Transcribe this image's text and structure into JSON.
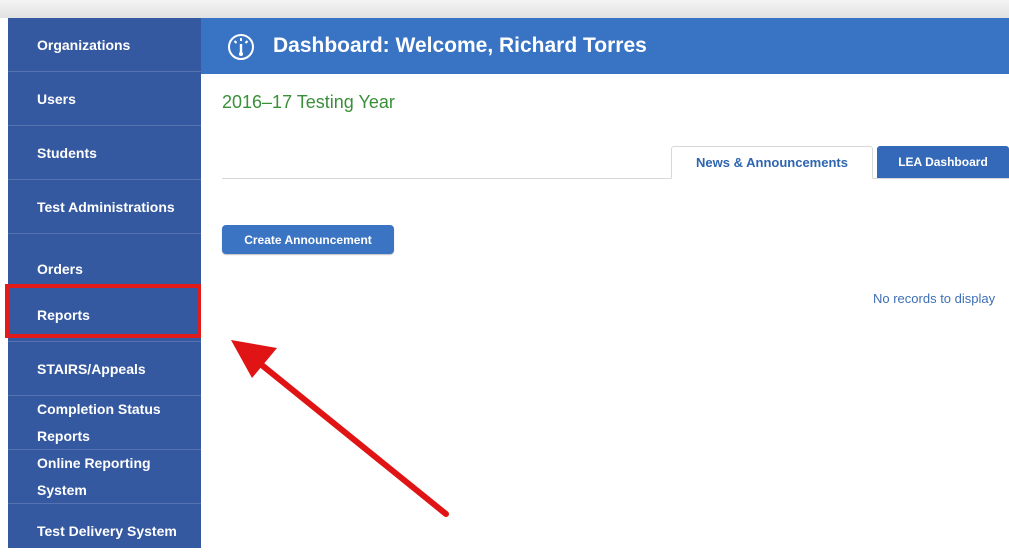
{
  "sidebar": {
    "items": [
      {
        "label": "Organizations"
      },
      {
        "label": "Users"
      },
      {
        "label": "Students"
      },
      {
        "label": "Test Administrations"
      },
      {
        "label": "Orders"
      },
      {
        "label": "Reports"
      },
      {
        "label": "STAIRS/Appeals"
      },
      {
        "line1": "Completion Status",
        "line2": "Reports"
      },
      {
        "line1": "Online Reporting",
        "line2": "System"
      },
      {
        "label": "Test Delivery System"
      }
    ]
  },
  "header": {
    "title": "Dashboard: Welcome, Richard Torres",
    "icon": "dashboard-gauge-icon"
  },
  "main": {
    "testing_year": "2016–17 Testing Year",
    "tabs": [
      {
        "label": "News & Announcements",
        "active": true
      },
      {
        "label": "LEA Dashboard",
        "active": false
      }
    ],
    "create_button": "Create Announcement",
    "empty_message": "No records to display"
  },
  "annotation": {
    "highlight_color": "#e11a1a",
    "highlighted_item": "Reports"
  },
  "colors": {
    "sidebar_bg": "#3559a0",
    "header_bg": "#3973c4",
    "year_text": "#3a8f3a",
    "button_bg": "#3a74c3"
  }
}
